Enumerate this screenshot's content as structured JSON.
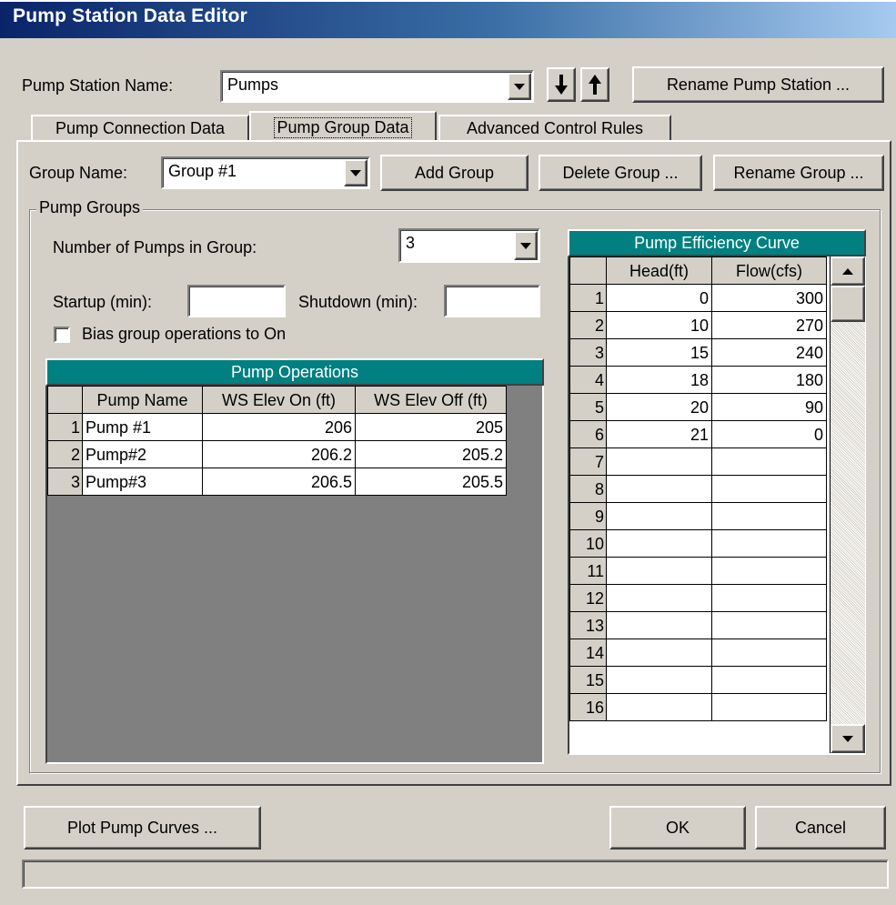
{
  "window": {
    "title": "Pump Station Data Editor"
  },
  "station": {
    "label": "Pump Station Name:",
    "name": "Pumps",
    "rename_label": "Rename Pump Station ..."
  },
  "tabs": [
    {
      "label": "Pump Connection Data",
      "active": false
    },
    {
      "label": "Pump Group Data",
      "active": true
    },
    {
      "label": "Advanced Control Rules",
      "active": false
    }
  ],
  "group": {
    "label": "Group Name:",
    "name": "Group #1",
    "add_label": "Add Group",
    "delete_label": "Delete Group ...",
    "rename_label": "Rename Group ..."
  },
  "pump_groups": {
    "legend": "Pump Groups",
    "num_pumps_label": "Number of Pumps in Group:",
    "num_pumps": "3",
    "startup_label": "Startup (min):",
    "startup_value": "",
    "shutdown_label": "Shutdown (min):",
    "shutdown_value": "",
    "bias_label": "Bias group operations to On",
    "bias_checked": false
  },
  "pump_operations": {
    "title": "Pump Operations",
    "columns": [
      "Pump Name",
      "WS Elev On (ft)",
      "WS Elev Off (ft)"
    ],
    "rows": [
      {
        "num": "1",
        "name": "Pump #1",
        "on": "206",
        "off": "205"
      },
      {
        "num": "2",
        "name": "Pump#2",
        "on": "206.2",
        "off": "205.2"
      },
      {
        "num": "3",
        "name": "Pump#3",
        "on": "206.5",
        "off": "205.5"
      }
    ]
  },
  "efficiency": {
    "title": "Pump Efficiency Curve",
    "columns": [
      "Head(ft)",
      "Flow(cfs)"
    ],
    "rows": [
      {
        "num": "1",
        "head": "0",
        "flow": "300"
      },
      {
        "num": "2",
        "head": "10",
        "flow": "270"
      },
      {
        "num": "3",
        "head": "15",
        "flow": "240"
      },
      {
        "num": "4",
        "head": "18",
        "flow": "180"
      },
      {
        "num": "5",
        "head": "20",
        "flow": "90"
      },
      {
        "num": "6",
        "head": "21",
        "flow": "0"
      },
      {
        "num": "7",
        "head": "",
        "flow": ""
      },
      {
        "num": "8",
        "head": "",
        "flow": ""
      },
      {
        "num": "9",
        "head": "",
        "flow": ""
      },
      {
        "num": "10",
        "head": "",
        "flow": ""
      },
      {
        "num": "11",
        "head": "",
        "flow": ""
      },
      {
        "num": "12",
        "head": "",
        "flow": ""
      },
      {
        "num": "13",
        "head": "",
        "flow": ""
      },
      {
        "num": "14",
        "head": "",
        "flow": ""
      },
      {
        "num": "15",
        "head": "",
        "flow": ""
      },
      {
        "num": "16",
        "head": "",
        "flow": ""
      }
    ]
  },
  "footer": {
    "plot_label": "Plot Pump Curves ...",
    "ok_label": "OK",
    "cancel_label": "Cancel",
    "status_text": ""
  },
  "icons": {
    "move_down": "arrow-down-icon",
    "move_up": "arrow-up-icon",
    "dropdown": "chevron-down-icon"
  },
  "colors": {
    "title_bar_start": "#0a246a",
    "title_bar_end": "#a6caf0",
    "grid_header": "#008080",
    "window_face": "#d4d0c8",
    "grid_empty_area": "#808080"
  }
}
